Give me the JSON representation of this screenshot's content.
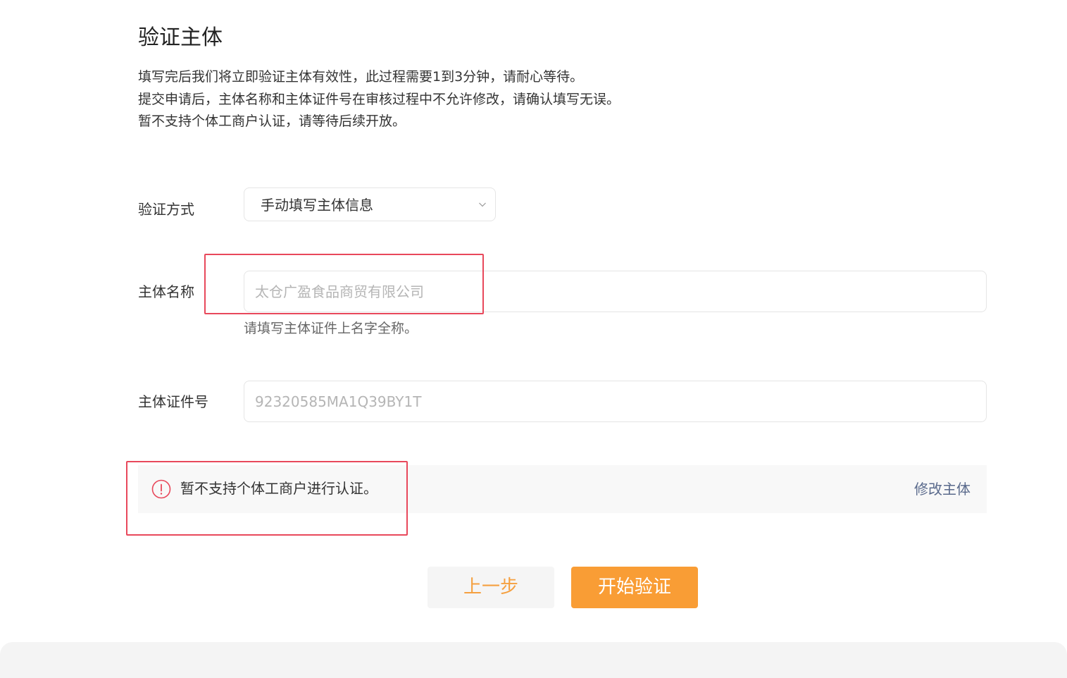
{
  "section": {
    "title": "验证主体",
    "description": [
      "填写完后我们将立即验证主体有效性，此过程需要1到3分钟，请耐心等待。",
      "提交申请后，主体名称和主体证件号在审核过程中不允许修改，请确认填写无误。",
      "暂不支持个体工商户认证，请等待后续开放。"
    ]
  },
  "form": {
    "method": {
      "label": "验证方式",
      "value": "手动填写主体信息"
    },
    "entity_name": {
      "label": "主体名称",
      "value": "太仓广盈食品商贸有限公司",
      "help": "请填写主体证件上名字全称。"
    },
    "entity_id": {
      "label": "主体证件号",
      "value": "92320585MA1Q39BY1T"
    }
  },
  "notice": {
    "icon": "alert-circle-icon",
    "text": "暂不支持个体工商户进行认证。",
    "action": "修改主体"
  },
  "buttons": {
    "prev": "上一步",
    "start": "开始验证"
  },
  "colors": {
    "accent": "#f99d35",
    "link": "#5a6a8c",
    "alert": "#e8485b"
  }
}
